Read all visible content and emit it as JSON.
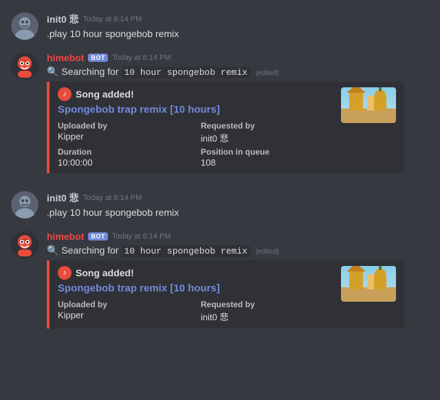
{
  "messages": [
    {
      "id": "msg1",
      "type": "user",
      "avatar": "user",
      "username": "init0 悲",
      "timestamp": "Today at 6:14 PM",
      "text": ".play 10 hour spongebob remix"
    },
    {
      "id": "msg2",
      "type": "bot",
      "avatar": "bot",
      "username": "himebot",
      "badge": "BOT",
      "timestamp": "Today at 6:14 PM",
      "searchText": "Searching for",
      "searchQuery": "10 hour spongebob remix",
      "edited": "(edited)",
      "embed": {
        "songAdded": "Song added!",
        "songName": "Spongebob trap remix [10 hours]",
        "fields": [
          {
            "label": "Uploaded by",
            "value": "Kipper"
          },
          {
            "label": "Requested by",
            "value": "init0 悲"
          },
          {
            "label": "Duration",
            "value": "10:00:00"
          },
          {
            "label": "Position in queue",
            "value": "108"
          }
        ]
      }
    },
    {
      "id": "msg3",
      "type": "user",
      "avatar": "user",
      "username": "init0 悲",
      "timestamp": "Today at 6:14 PM",
      "text": ".play 10 hour spongebob remix"
    },
    {
      "id": "msg4",
      "type": "bot",
      "avatar": "bot",
      "username": "himebot",
      "badge": "BOT",
      "timestamp": "Today at 6:14 PM",
      "searchText": "Searching for",
      "searchQuery": "10 hour spongebob remix",
      "edited": "(edited)",
      "embed": {
        "songAdded": "Song added!",
        "songName": "Spongebob trap remix [10 hours]",
        "fields": [
          {
            "label": "Uploaded by",
            "value": "Kipper"
          },
          {
            "label": "Requested by",
            "value": "init0 悲"
          }
        ]
      }
    }
  ],
  "ui": {
    "botBadge": "BOT"
  }
}
